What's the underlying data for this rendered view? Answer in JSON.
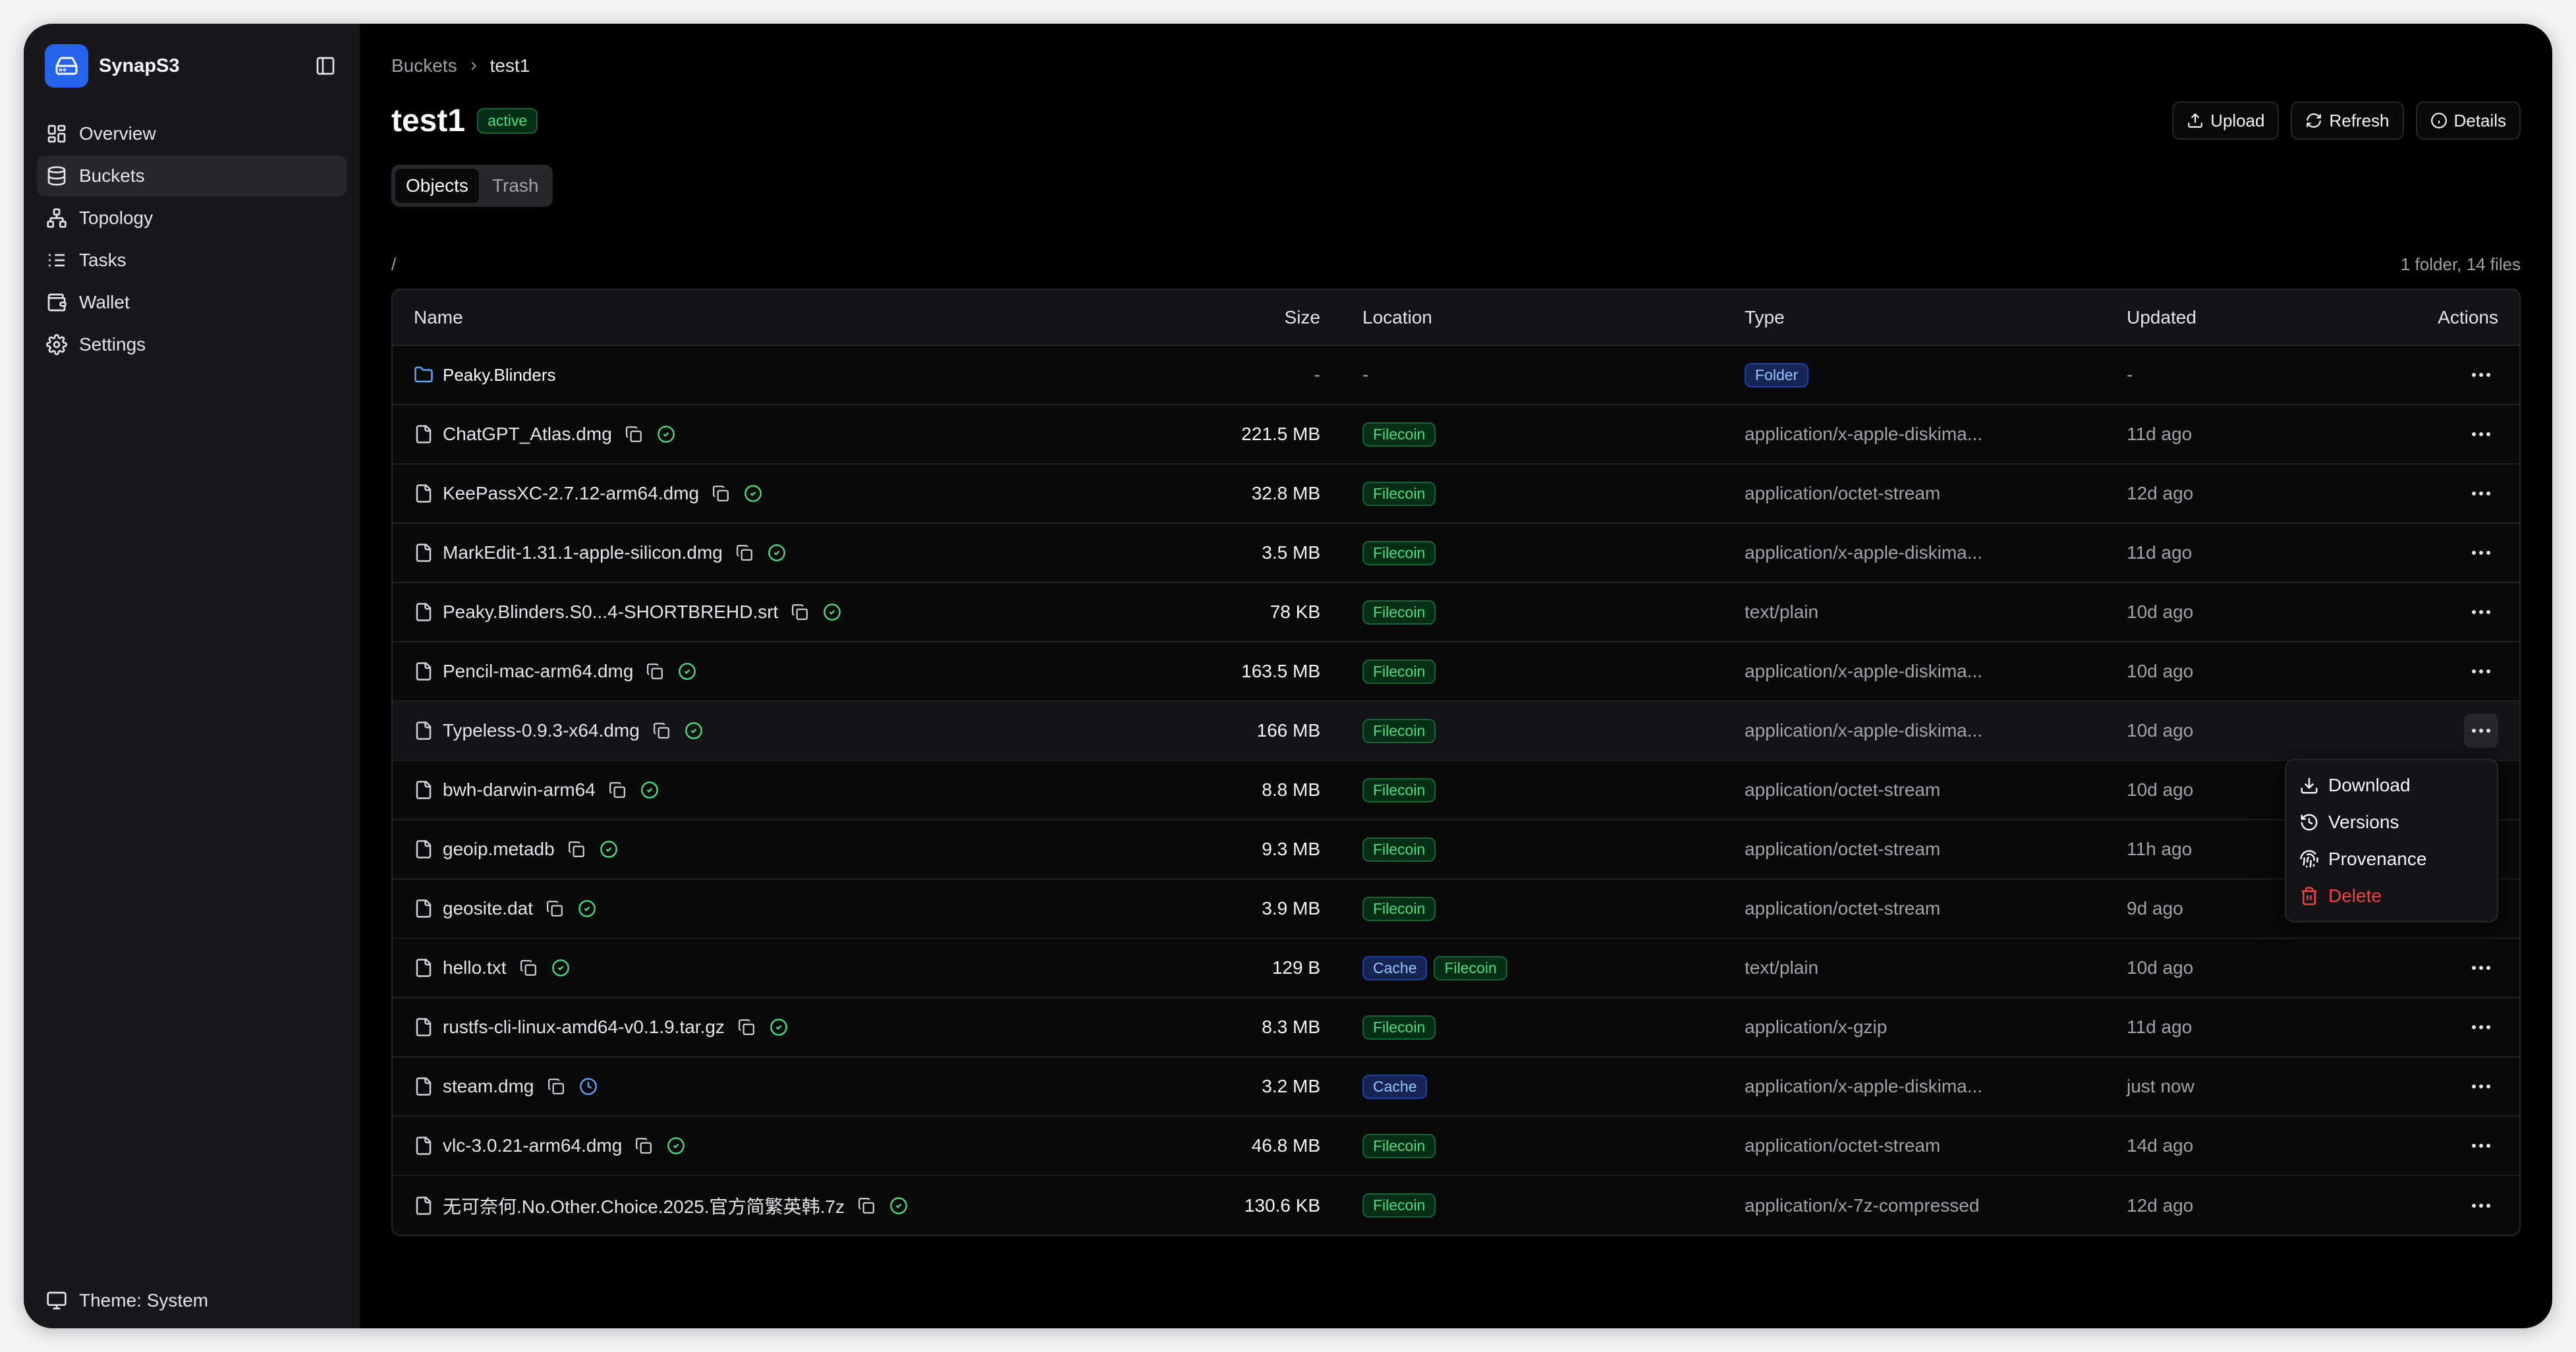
{
  "app": {
    "name": "SynapS3"
  },
  "sidebar": {
    "items": [
      {
        "label": "Overview",
        "icon": "grid-icon"
      },
      {
        "label": "Buckets",
        "icon": "database-icon"
      },
      {
        "label": "Topology",
        "icon": "network-icon"
      },
      {
        "label": "Tasks",
        "icon": "list-icon"
      },
      {
        "label": "Wallet",
        "icon": "wallet-icon"
      },
      {
        "label": "Settings",
        "icon": "gear-icon"
      }
    ],
    "active": "Buckets",
    "theme_label": "Theme: System"
  },
  "breadcrumb": {
    "root": "Buckets",
    "current": "test1"
  },
  "header": {
    "title": "test1",
    "status": "active",
    "upload_label": "Upload",
    "refresh_label": "Refresh",
    "details_label": "Details"
  },
  "tabs": [
    {
      "label": "Objects"
    },
    {
      "label": "Trash"
    }
  ],
  "path": {
    "current": "/",
    "summary": "1 folder, 14 files"
  },
  "table": {
    "headers": {
      "name": "Name",
      "size": "Size",
      "location": "Location",
      "type": "Type",
      "updated": "Updated",
      "actions": "Actions"
    },
    "folder": {
      "name": "Peaky.Blinders",
      "size": "-",
      "location": "-",
      "type": "Folder",
      "updated": "-"
    },
    "rows": [
      {
        "name": "ChatGPT_Atlas.dmg",
        "size": "221.5 MB",
        "locations": [
          "Filecoin"
        ],
        "type": "application/x-apple-diskima...",
        "updated": "11d ago",
        "status": "synced"
      },
      {
        "name": "KeePassXC-2.7.12-arm64.dmg",
        "size": "32.8 MB",
        "locations": [
          "Filecoin"
        ],
        "type": "application/octet-stream",
        "updated": "12d ago",
        "status": "synced"
      },
      {
        "name": "MarkEdit-1.31.1-apple-silicon.dmg",
        "size": "3.5 MB",
        "locations": [
          "Filecoin"
        ],
        "type": "application/x-apple-diskima...",
        "updated": "11d ago",
        "status": "synced"
      },
      {
        "name": "Peaky.Blinders.S0...4-SHORTBREHD.srt",
        "size": "78 KB",
        "locations": [
          "Filecoin"
        ],
        "type": "text/plain",
        "updated": "10d ago",
        "status": "synced"
      },
      {
        "name": "Pencil-mac-arm64.dmg",
        "size": "163.5 MB",
        "locations": [
          "Filecoin"
        ],
        "type": "application/x-apple-diskima...",
        "updated": "10d ago",
        "status": "synced"
      },
      {
        "name": "Typeless-0.9.3-x64.dmg",
        "size": "166 MB",
        "locations": [
          "Filecoin"
        ],
        "type": "application/x-apple-diskima...",
        "updated": "10d ago",
        "status": "synced"
      },
      {
        "name": "bwh-darwin-arm64",
        "size": "8.8 MB",
        "locations": [
          "Filecoin"
        ],
        "type": "application/octet-stream",
        "updated": "10d ago",
        "status": "synced"
      },
      {
        "name": "geoip.metadb",
        "size": "9.3 MB",
        "locations": [
          "Filecoin"
        ],
        "type": "application/octet-stream",
        "updated": "11h ago",
        "status": "synced"
      },
      {
        "name": "geosite.dat",
        "size": "3.9 MB",
        "locations": [
          "Filecoin"
        ],
        "type": "application/octet-stream",
        "updated": "9d ago",
        "status": "synced"
      },
      {
        "name": "hello.txt",
        "size": "129 B",
        "locations": [
          "Cache",
          "Filecoin"
        ],
        "type": "text/plain",
        "updated": "10d ago",
        "status": "synced"
      },
      {
        "name": "rustfs-cli-linux-amd64-v0.1.9.tar.gz",
        "size": "8.3 MB",
        "locations": [
          "Filecoin"
        ],
        "type": "application/x-gzip",
        "updated": "11d ago",
        "status": "synced"
      },
      {
        "name": "steam.dmg",
        "size": "3.2 MB",
        "locations": [
          "Cache"
        ],
        "type": "application/x-apple-diskima...",
        "updated": "just now",
        "status": "pending"
      },
      {
        "name": "vlc-3.0.21-arm64.dmg",
        "size": "46.8 MB",
        "locations": [
          "Filecoin"
        ],
        "type": "application/octet-stream",
        "updated": "14d ago",
        "status": "synced"
      },
      {
        "name": "无可奈何.No.Other.Choice.2025.官方简繁英韩.7z",
        "size": "130.6 KB",
        "locations": [
          "Filecoin"
        ],
        "type": "application/x-7z-compressed",
        "updated": "12d ago",
        "status": "synced"
      }
    ]
  },
  "context_menu": {
    "items": [
      {
        "label": "Download",
        "icon": "download-icon"
      },
      {
        "label": "Versions",
        "icon": "history-icon"
      },
      {
        "label": "Provenance",
        "icon": "fingerprint-icon"
      },
      {
        "label": "Delete",
        "icon": "trash-icon"
      }
    ]
  },
  "colors": {
    "accent": "#2563eb",
    "success": "#4ade80",
    "info": "#93c5fd",
    "danger": "#ef4444",
    "background": "#000000",
    "sidebar": "#18181b"
  }
}
